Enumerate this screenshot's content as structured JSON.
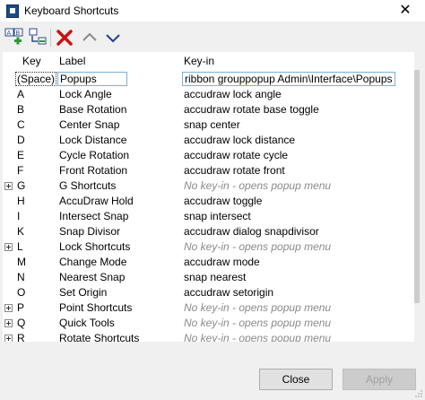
{
  "window": {
    "title": "Keyboard Shortcuts",
    "close_glyph": "✕"
  },
  "toolbar": {
    "icons": [
      "new-shortcut-icon",
      "new-child-shortcut-icon",
      "delete-icon",
      "move-up-icon",
      "move-down-icon"
    ],
    "colors": {
      "delete": "#cc1111",
      "arrow": "#1f3f8f",
      "add": "#2a9a2a"
    },
    "new_a_label": "A",
    "new_b_label": "B"
  },
  "list": {
    "headers": {
      "key": "Key",
      "label": "Label",
      "keyin": "Key-in"
    },
    "rows": [
      {
        "key": "(Space)",
        "label": "Popups",
        "keyin": "ribbon grouppopup Admin\\Interface\\Popups",
        "expandable": false,
        "placeholder": false,
        "selected": true
      },
      {
        "key": "A",
        "label": "Lock Angle",
        "keyin": "accudraw lock angle",
        "expandable": false,
        "placeholder": false
      },
      {
        "key": "B",
        "label": "Base Rotation",
        "keyin": "accudraw rotate base toggle",
        "expandable": false,
        "placeholder": false
      },
      {
        "key": "C",
        "label": "Center Snap",
        "keyin": "snap center",
        "expandable": false,
        "placeholder": false
      },
      {
        "key": "D",
        "label": "Lock Distance",
        "keyin": "accudraw lock distance",
        "expandable": false,
        "placeholder": false
      },
      {
        "key": "E",
        "label": "Cycle Rotation",
        "keyin": "accudraw rotate cycle",
        "expandable": false,
        "placeholder": false
      },
      {
        "key": "F",
        "label": "Front Rotation",
        "keyin": "accudraw rotate front",
        "expandable": false,
        "placeholder": false
      },
      {
        "key": "G",
        "label": "G Shortcuts",
        "keyin": "No key-in - opens popup menu",
        "expandable": true,
        "placeholder": true
      },
      {
        "key": "H",
        "label": "AccuDraw Hold",
        "keyin": "accudraw toggle",
        "expandable": false,
        "placeholder": false
      },
      {
        "key": "I",
        "label": "Intersect Snap",
        "keyin": "snap intersect",
        "expandable": false,
        "placeholder": false
      },
      {
        "key": "K",
        "label": "Snap Divisor",
        "keyin": "accudraw dialog snapdivisor",
        "expandable": false,
        "placeholder": false
      },
      {
        "key": "L",
        "label": "Lock Shortcuts",
        "keyin": "No key-in - opens popup menu",
        "expandable": true,
        "placeholder": true
      },
      {
        "key": "M",
        "label": "Change Mode",
        "keyin": "accudraw mode",
        "expandable": false,
        "placeholder": false
      },
      {
        "key": "N",
        "label": "Nearest Snap",
        "keyin": "snap nearest",
        "expandable": false,
        "placeholder": false
      },
      {
        "key": "O",
        "label": "Set Origin",
        "keyin": "accudraw setorigin",
        "expandable": false,
        "placeholder": false
      },
      {
        "key": "P",
        "label": "Point Shortcuts",
        "keyin": "No key-in - opens popup menu",
        "expandable": true,
        "placeholder": true
      },
      {
        "key": "Q",
        "label": "Quick Tools",
        "keyin": "No key-in - opens popup menu",
        "expandable": true,
        "placeholder": true
      },
      {
        "key": "R",
        "label": "Rotate Shortcuts",
        "keyin": "No key-in - opens popup menu",
        "expandable": true,
        "placeholder": true
      }
    ]
  },
  "buttons": {
    "close": "Close",
    "apply": "Apply"
  }
}
